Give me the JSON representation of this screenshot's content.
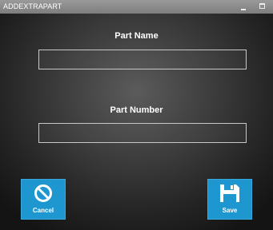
{
  "window": {
    "title": "ADDEXTRAPART"
  },
  "form": {
    "part_name_label": "Part Name",
    "part_name_value": "",
    "part_number_label": "Part Number",
    "part_number_value": ""
  },
  "actions": {
    "cancel_label": "Cancel",
    "cancel_icon": "cancel-icon",
    "save_label": "Save",
    "save_icon": "floppy-disk-icon"
  },
  "colors": {
    "titlebar": "#8c8c8c",
    "background": "#2a2a2a",
    "accent": "#1e96cf",
    "text": "#ffffff"
  }
}
